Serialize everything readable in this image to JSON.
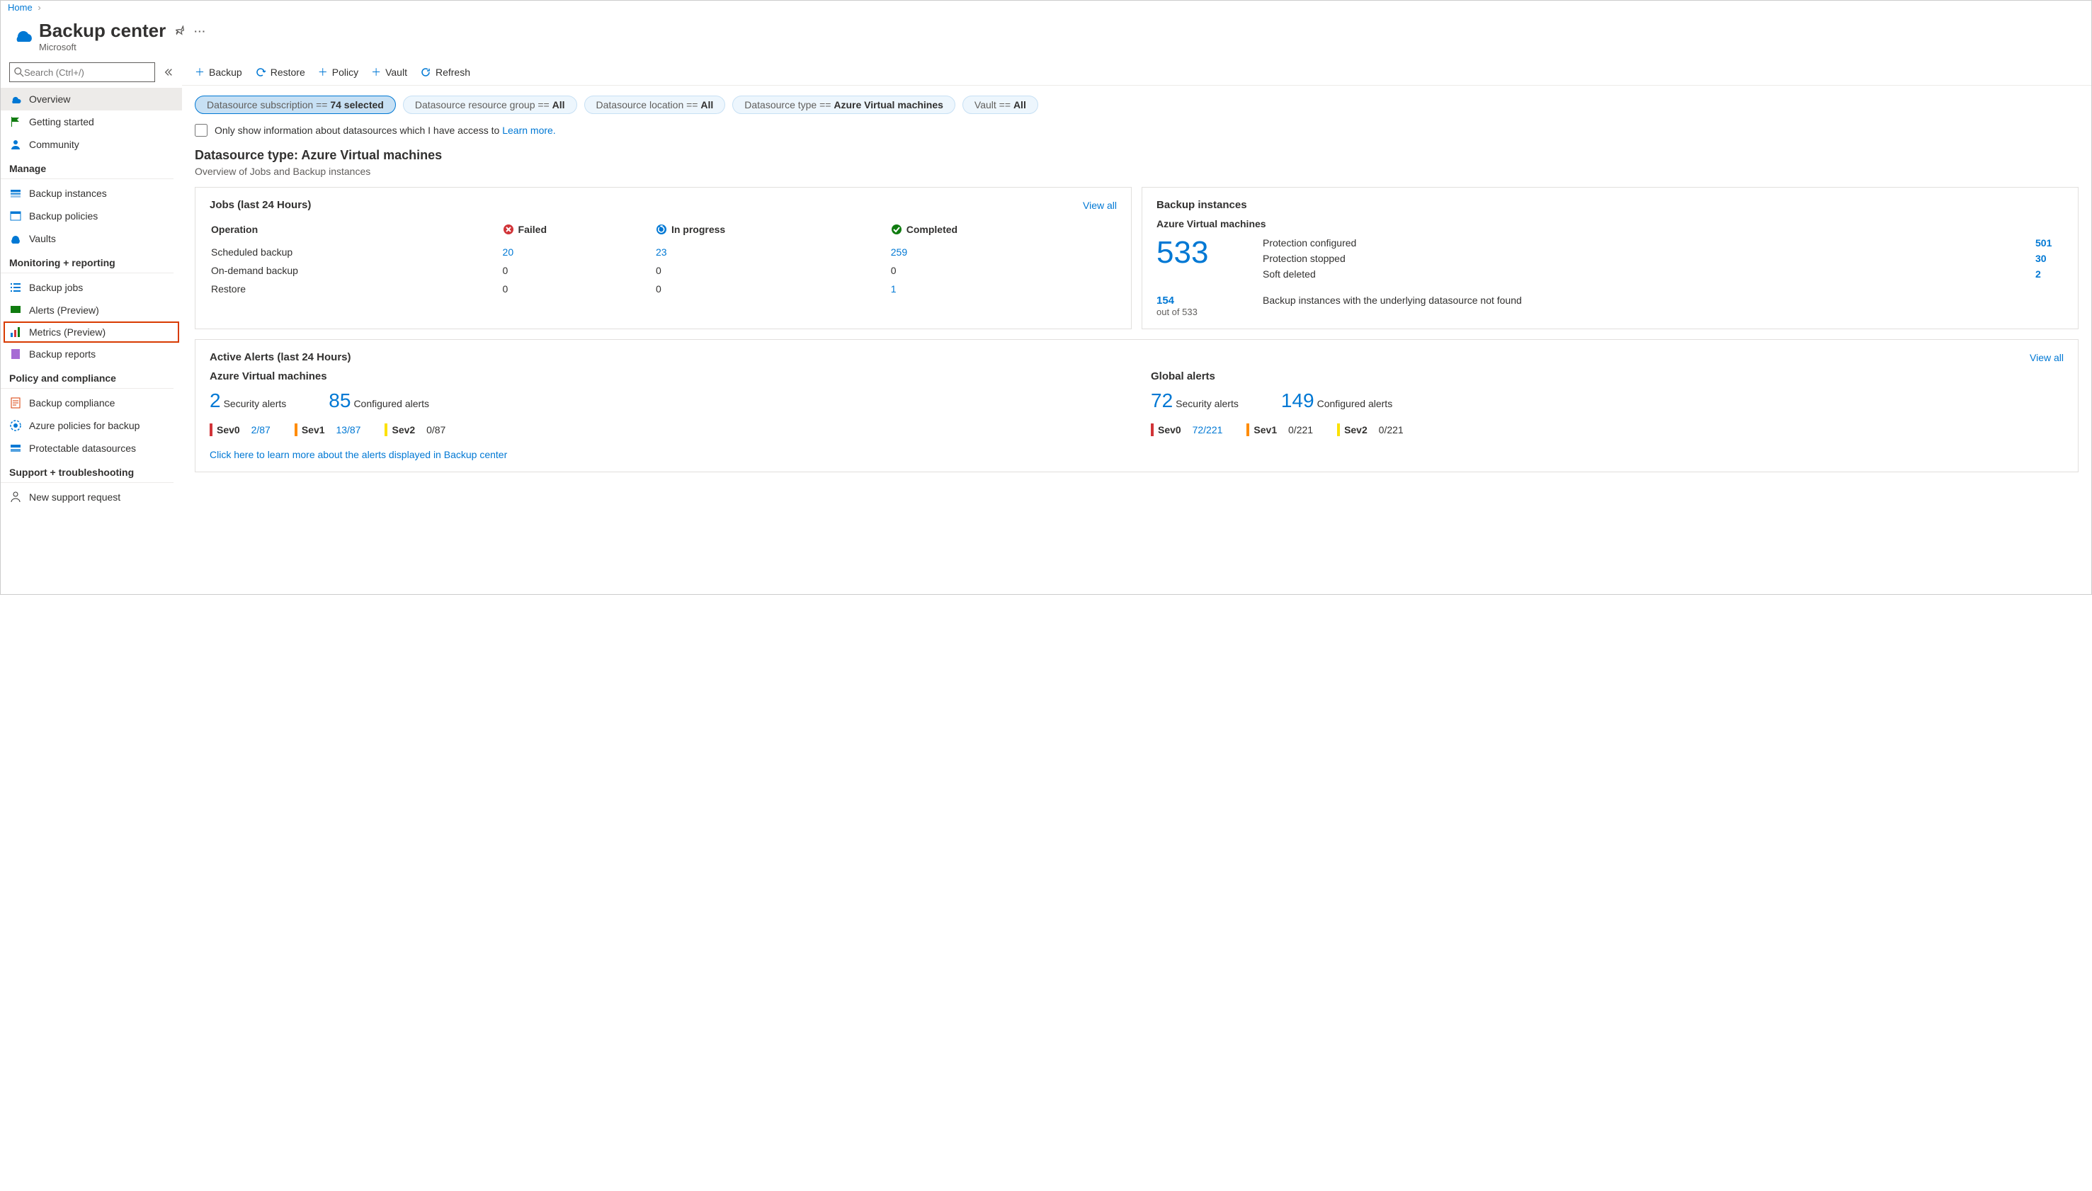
{
  "breadcrumb": {
    "home": "Home"
  },
  "header": {
    "title": "Backup center",
    "subtitle": "Microsoft"
  },
  "search": {
    "placeholder": "Search (Ctrl+/)"
  },
  "nav": {
    "overview": "Overview",
    "getting_started": "Getting started",
    "community": "Community",
    "manage": "Manage",
    "backup_instances": "Backup instances",
    "backup_policies": "Backup policies",
    "vaults": "Vaults",
    "monitoring": "Monitoring + reporting",
    "backup_jobs": "Backup jobs",
    "alerts_preview": "Alerts (Preview)",
    "metrics_preview": "Metrics (Preview)",
    "backup_reports": "Backup reports",
    "policy_compliance": "Policy and compliance",
    "backup_compliance": "Backup compliance",
    "azure_policies": "Azure policies for backup",
    "protectable_ds": "Protectable datasources",
    "support": "Support + troubleshooting",
    "new_request": "New support request"
  },
  "toolbar": {
    "backup": "Backup",
    "restore": "Restore",
    "policy": "Policy",
    "vault": "Vault",
    "refresh": "Refresh"
  },
  "filters": {
    "f1_k": "Datasource subscription == ",
    "f1_v": "74 selected",
    "f2_k": "Datasource resource group == ",
    "f2_v": "All",
    "f3_k": "Datasource location == ",
    "f3_v": "All",
    "f4_k": "Datasource type == ",
    "f4_v": "Azure Virtual machines",
    "f5_k": "Vault == ",
    "f5_v": "All"
  },
  "checkbox_text": "Only show information about datasources which I have access to ",
  "learn_more": "Learn more.",
  "section": {
    "title": "Datasource type: Azure Virtual machines",
    "sub": "Overview of Jobs and Backup instances"
  },
  "jobs_card": {
    "title": "Jobs (last 24 Hours)",
    "view_all": "View all",
    "col_op": "Operation",
    "col_failed": "Failed",
    "col_progress": "In progress",
    "col_completed": "Completed",
    "r1_op": "Scheduled backup",
    "r1_f": "20",
    "r1_p": "23",
    "r1_c": "259",
    "r2_op": "On-demand backup",
    "r2_f": "0",
    "r2_p": "0",
    "r2_c": "0",
    "r3_op": "Restore",
    "r3_f": "0",
    "r3_p": "0",
    "r3_c": "1"
  },
  "inst_card": {
    "title": "Backup instances",
    "subtitle": "Azure Virtual machines",
    "total": "533",
    "r1_l": "Protection configured",
    "r1_v": "501",
    "r2_l": "Protection stopped",
    "r2_v": "30",
    "r3_l": "Soft deleted",
    "r3_v": "2",
    "sub_count": "154",
    "sub_text": "out of 533",
    "note": "Backup instances with the underlying datasource not found"
  },
  "alerts_card": {
    "title": "Active Alerts (last 24 Hours)",
    "view_all": "View all",
    "col1_title": "Azure Virtual machines",
    "col1_sec_n": "2",
    "col1_sec_l": "Security alerts",
    "col1_cfg_n": "85",
    "col1_cfg_l": "Configured alerts",
    "col1_s0_l": "Sev0",
    "col1_s0_v": "2/87",
    "col1_s1_l": "Sev1",
    "col1_s1_v": "13/87",
    "col1_s2_l": "Sev2",
    "col1_s2_v": "0/87",
    "col2_title": "Global alerts",
    "col2_sec_n": "72",
    "col2_sec_l": "Security alerts",
    "col2_cfg_n": "149",
    "col2_cfg_l": "Configured alerts",
    "col2_s0_l": "Sev0",
    "col2_s0_v": "72/221",
    "col2_s1_l": "Sev1",
    "col2_s1_v": "0/221",
    "col2_s2_l": "Sev2",
    "col2_s2_v": "0/221",
    "learn_link": "Click here to learn more about the alerts displayed in Backup center"
  }
}
